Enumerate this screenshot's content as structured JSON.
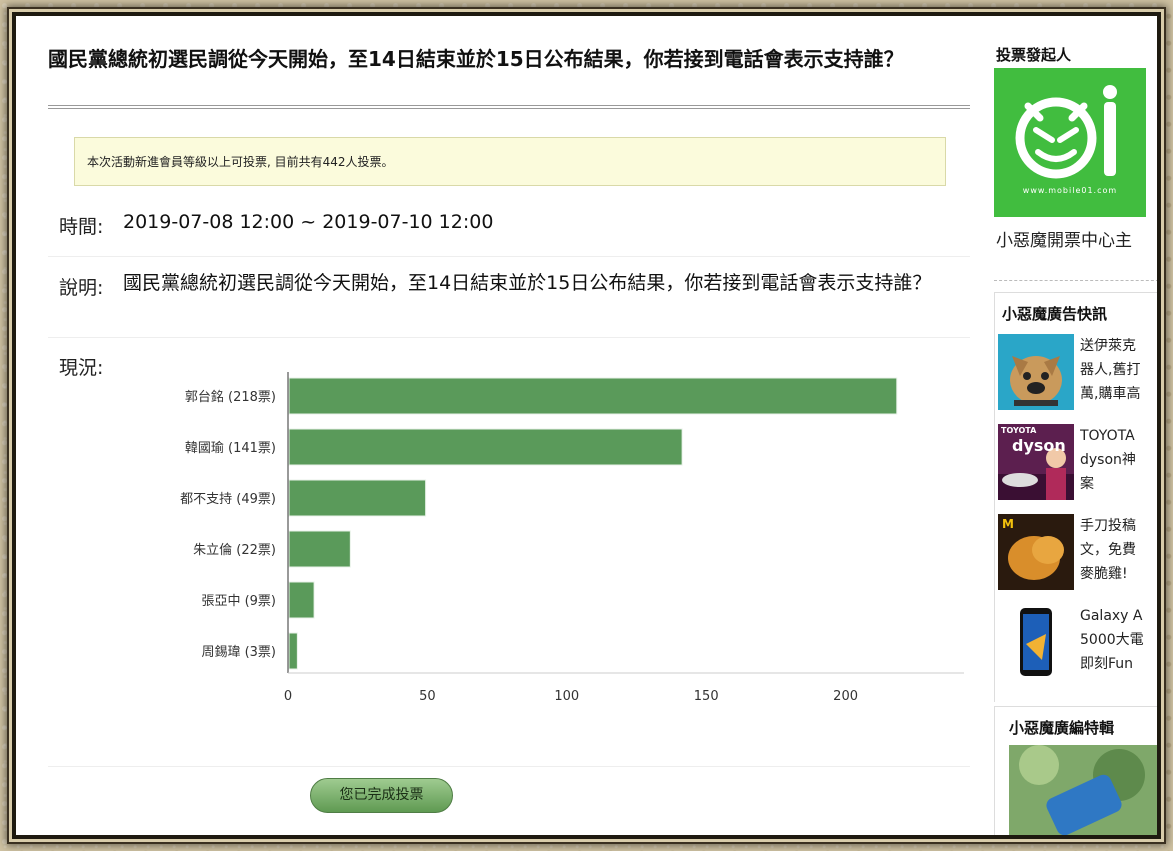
{
  "poll": {
    "title": "國民黨總統初選民調從今天開始，至14日結束並於15日公布結果，你若接到電話會表示支持誰？",
    "notice": "本次活動新進會員等級以上可投票, 目前共有442人投票。",
    "time_label": "時間:",
    "time_value": "2019-07-08 12:00 ~ 2019-07-10 12:00",
    "desc_label": "說明:",
    "desc_value": "國民黨總統初選民調從今天開始，至14日結束並於15日公布結果，你若接到電話會表示支持誰？",
    "status_label": "現況:",
    "vote_button": "您已完成投票"
  },
  "chart_data": {
    "type": "bar",
    "orientation": "horizontal",
    "categories": [
      "郭台銘 (218票)",
      "韓國瑜 (141票)",
      "都不支持 (49票)",
      "朱立倫 (22票)",
      "張亞中 (9票)",
      "周錫瑋 (3票)"
    ],
    "values": [
      218,
      141,
      49,
      22,
      9,
      3
    ],
    "xlim": [
      0,
      250
    ],
    "xticks": [
      "0",
      "50",
      "100",
      "150",
      "200",
      "250"
    ],
    "grid": false,
    "bar_color": "#5a9a5a"
  },
  "sidebar": {
    "initiator_title": "投票發起人",
    "logo_url_text": "www.mobile01.com",
    "initiator_name": "小惡魔開票中心主",
    "ads_title": "小惡魔廣告快訊",
    "ads": [
      {
        "lines": [
          "送伊萊克",
          "器人,舊打",
          "萬,購車高"
        ]
      },
      {
        "lines": [
          "TOYOTA",
          "dyson神",
          "案"
        ],
        "thumb_text": "dyson",
        "thumb_brand": "TOYOTA"
      },
      {
        "lines": [
          "手刀投稿",
          "文，免費",
          "麥脆雞!"
        ]
      },
      {
        "lines": [
          "Galaxy A",
          "5000大電",
          "即刻Fun"
        ]
      }
    ],
    "special_title": "小惡魔廣編特輯"
  }
}
